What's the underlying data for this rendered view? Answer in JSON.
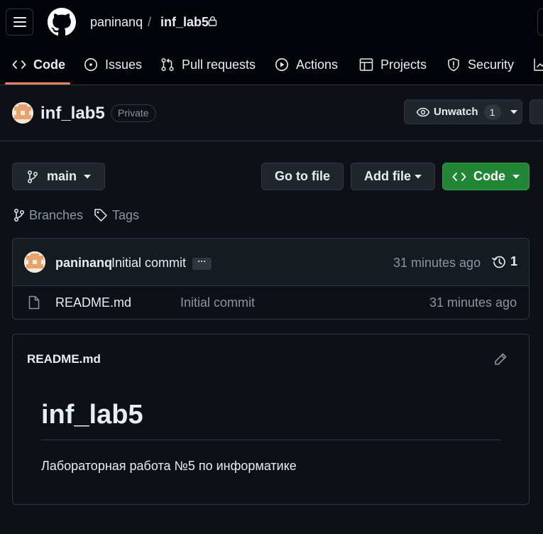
{
  "header": {
    "owner": "paninanq",
    "separator": "/",
    "repo": "inf_lab5"
  },
  "nav": {
    "tabs": [
      {
        "label": "Code",
        "icon": "code-icon"
      },
      {
        "label": "Issues",
        "icon": "issue-circle-icon"
      },
      {
        "label": "Pull requests",
        "icon": "pull-request-icon"
      },
      {
        "label": "Actions",
        "icon": "play-circle-icon"
      },
      {
        "label": "Projects",
        "icon": "table-icon"
      },
      {
        "label": "Security",
        "icon": "shield-icon"
      }
    ]
  },
  "repo": {
    "name": "inf_lab5",
    "visibility": "Private",
    "watch_label": "Unwatch",
    "watch_count": "1"
  },
  "toolbar": {
    "branch": "main",
    "go_to_file": "Go to file",
    "add_file": "Add file",
    "code": "Code",
    "branches": "Branches",
    "tags": "Tags"
  },
  "latest_commit": {
    "author": "paninanq",
    "message": "Initial commit",
    "dots": "···",
    "time": "31 minutes ago",
    "history_count": "1"
  },
  "files": [
    {
      "name": "README.md",
      "commit_message": "Initial commit",
      "time": "31 minutes ago"
    }
  ],
  "readme": {
    "label": "README.md",
    "heading": "inf_lab5",
    "paragraph": "Лабораторная работа №5 по информатике"
  },
  "colors": {
    "background": "#0d1117",
    "header_bg": "#010409",
    "border": "#30363d",
    "accent_underline": "#f78166",
    "primary_button": "#238636",
    "muted_text": "#8b949e"
  }
}
